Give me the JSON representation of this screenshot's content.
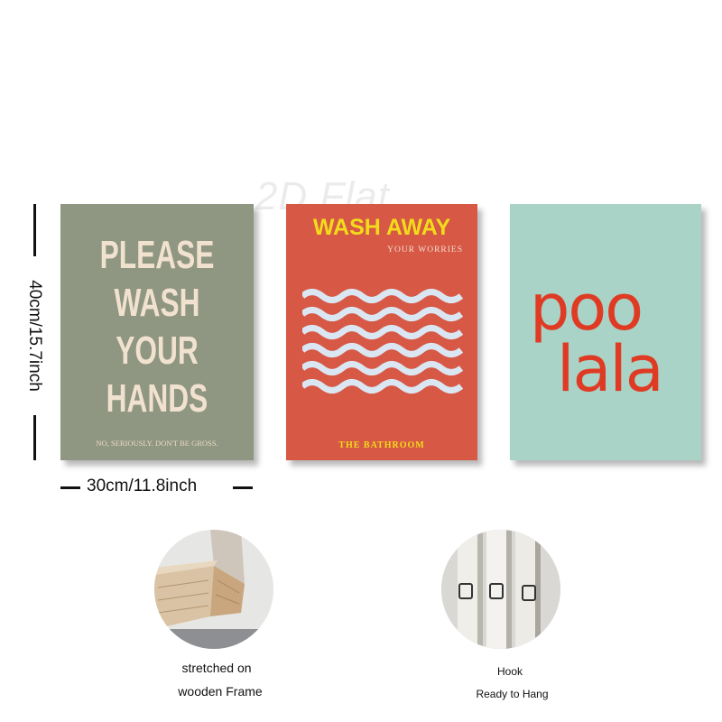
{
  "dimensions": {
    "height_label": "40cm/15.7inch",
    "width_label": "30cm/11.8inch"
  },
  "watermark": "2D Flat",
  "posters": [
    {
      "lines": [
        "PLEASE",
        "WASH",
        "YOUR",
        "HANDS"
      ],
      "footer": "NO, SERIOUSLY. DON'T BE GROSS.",
      "colors": {
        "background": "#8f9681",
        "text": "#f1e2cf"
      }
    },
    {
      "title": "WASH AWAY",
      "subtitle": "YOUR WORRIES",
      "footer": "THE BATHROOM",
      "colors": {
        "background": "#d65845",
        "title": "#f2dc1a",
        "waves": "#dbe6f3"
      }
    },
    {
      "line1": "poo",
      "line2": "lala",
      "colors": {
        "background": "#a9d3c6",
        "text": "#df3b24"
      }
    }
  ],
  "features": [
    {
      "icon": "wooden-frame-photo",
      "line1": "stretched on",
      "line2": "wooden Frame"
    },
    {
      "icon": "hook-photo",
      "line1": "Hook",
      "line2": "Ready to Hang"
    }
  ]
}
